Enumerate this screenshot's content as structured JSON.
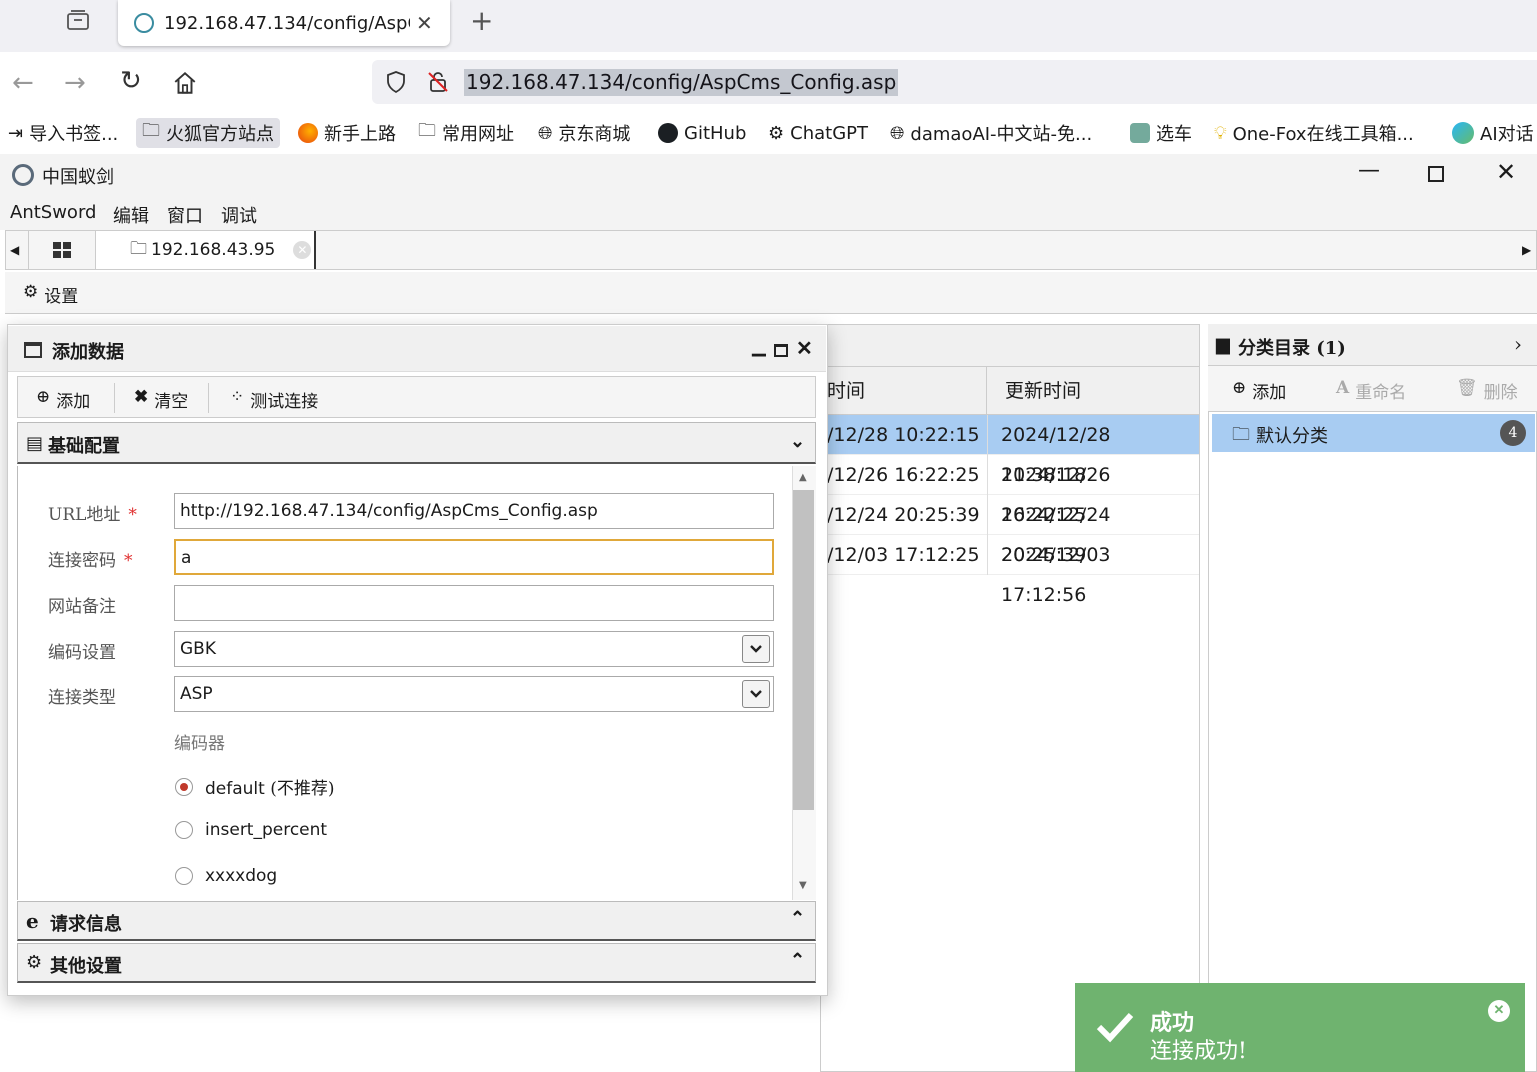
{
  "browser": {
    "tab_title": "192.168.47.134/config/AspC",
    "url": "192.168.47.134/config/AspCms_Config.asp",
    "bookmarks": [
      "导入书签...",
      "火狐官方站点",
      "新手上路",
      "常用网址",
      "京东商城",
      "GitHub",
      "ChatGPT",
      "damaoAI-中文站-免...",
      "选车",
      "One-Fox在线工具箱...",
      "AI对话"
    ]
  },
  "app": {
    "title": "中国蚁剑",
    "menu": [
      "AntSword",
      "编辑",
      "窗口",
      "调试"
    ],
    "tab_label": "192.168.43.95",
    "settings_label": "设置"
  },
  "grid": {
    "col_create": "时间",
    "col_update": "更新时间",
    "rows": [
      {
        "created": "/12/28 10:22:15",
        "updated": "2024/12/28 11:38:18"
      },
      {
        "created": "/12/26 16:22:25",
        "updated": "2024/12/26 16:22:25"
      },
      {
        "created": "/12/24 20:25:39",
        "updated": "2024/12/24 20:25:39"
      },
      {
        "created": "/12/03 17:12:25",
        "updated": "2024/12/03 17:12:56"
      }
    ]
  },
  "category": {
    "header": "分类目录 (1)",
    "add": "添加",
    "rename": "重命名",
    "delete": "删除",
    "item": "默认分类",
    "count": "4"
  },
  "dialog": {
    "title": "添加数据",
    "toolbar": {
      "add": "添加",
      "clear": "清空",
      "test": "测试连接"
    },
    "basic_section": "基础配置",
    "fields": {
      "url_label": "URL地址",
      "url_value": "http://192.168.47.134/config/AspCms_Config.asp",
      "password_label": "连接密码",
      "password_value": "a",
      "note_label": "网站备注",
      "note_value": "",
      "encoding_label": "编码设置",
      "encoding_value": "GBK",
      "type_label": "连接类型",
      "type_value": "ASP",
      "encoder_label": "编码器",
      "required_mark": "*"
    },
    "encoders": [
      {
        "name": "default",
        "note": "(不推荐)",
        "selected": true
      },
      {
        "name": "insert_percent",
        "note": "",
        "selected": false
      },
      {
        "name": "xxxxdog",
        "note": "",
        "selected": false
      }
    ],
    "request_section": "请求信息",
    "other_section": "其他设置"
  },
  "toast": {
    "title": "成功",
    "message": "连接成功!"
  },
  "colors": {
    "selection": "#a8ccf2",
    "toast": "#6fb36f",
    "focus": "#e0a83a"
  }
}
